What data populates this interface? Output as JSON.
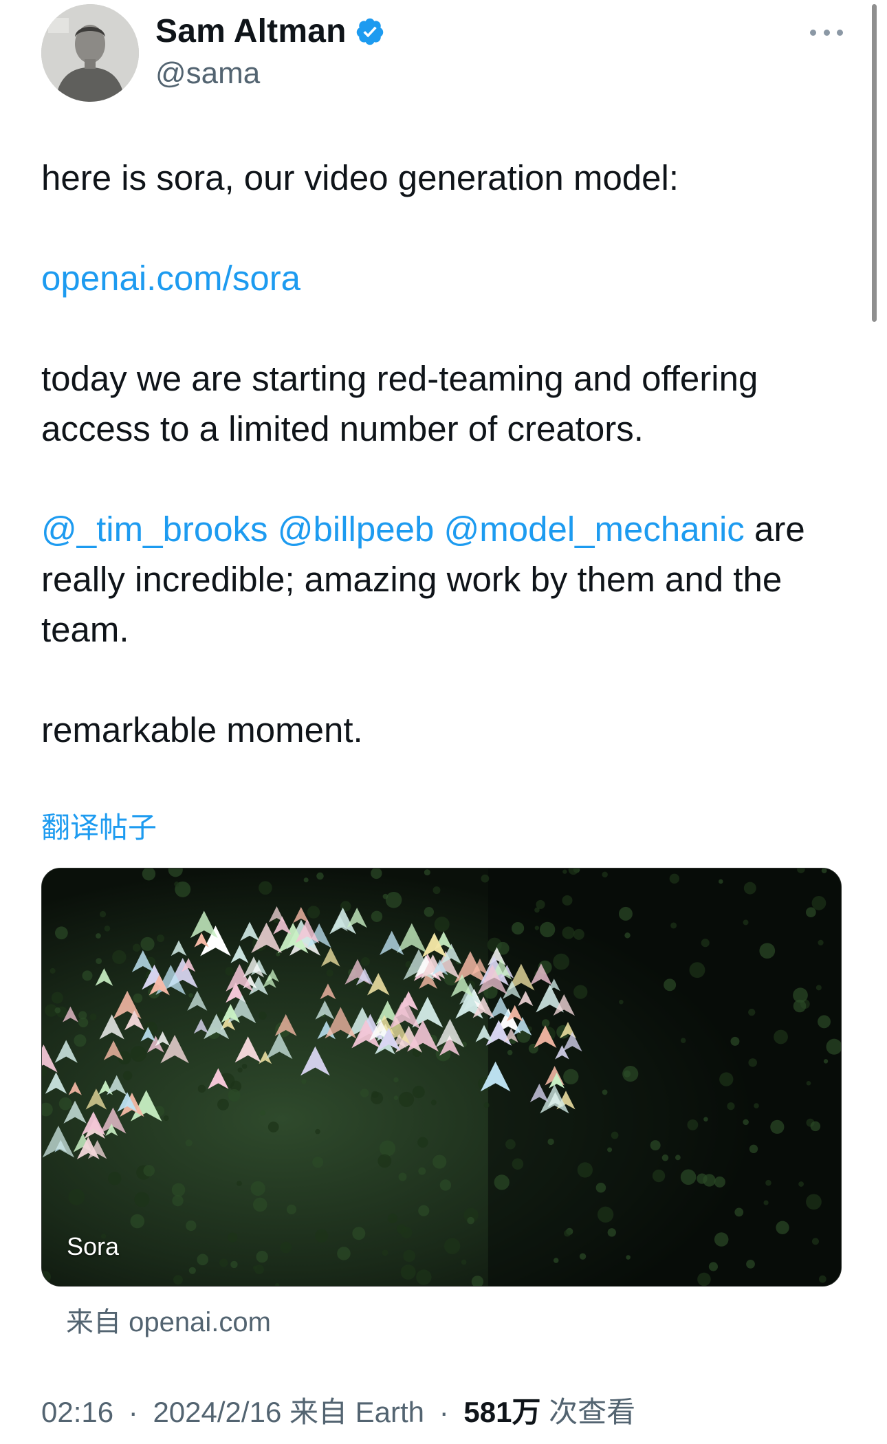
{
  "tweet": {
    "author": {
      "name": "Sam Altman",
      "handle": "@sama",
      "verified": true
    },
    "text": {
      "line1": "here is sora, our video generation model:",
      "link": "openai.com/sora",
      "para2": "today we are starting red-teaming and offering access to a limited number of creators.",
      "mention1": "@_tim_brooks",
      "mention2": "@billpeeb",
      "mention3": "@model_mechanic",
      "para3_rest": " are really incredible; amazing work by them and the team.",
      "para4": "remarkable moment."
    },
    "translate_label": "翻译帖子",
    "media": {
      "label": "Sora",
      "source": "来自 openai.com"
    },
    "meta": {
      "time": "02:16",
      "dot1": "·",
      "date": "2024/2/16",
      "via": "来自 Earth",
      "dot2": "·",
      "views_count": "581万",
      "views_label": "次查看"
    }
  },
  "colors": {
    "link": "#1d9bf0",
    "text": "#0f1419",
    "secondary": "#536471",
    "verified": "#1d9bf0"
  },
  "icons": {
    "verified": "verified-badge-icon",
    "more": "more-horizontal-icon"
  }
}
